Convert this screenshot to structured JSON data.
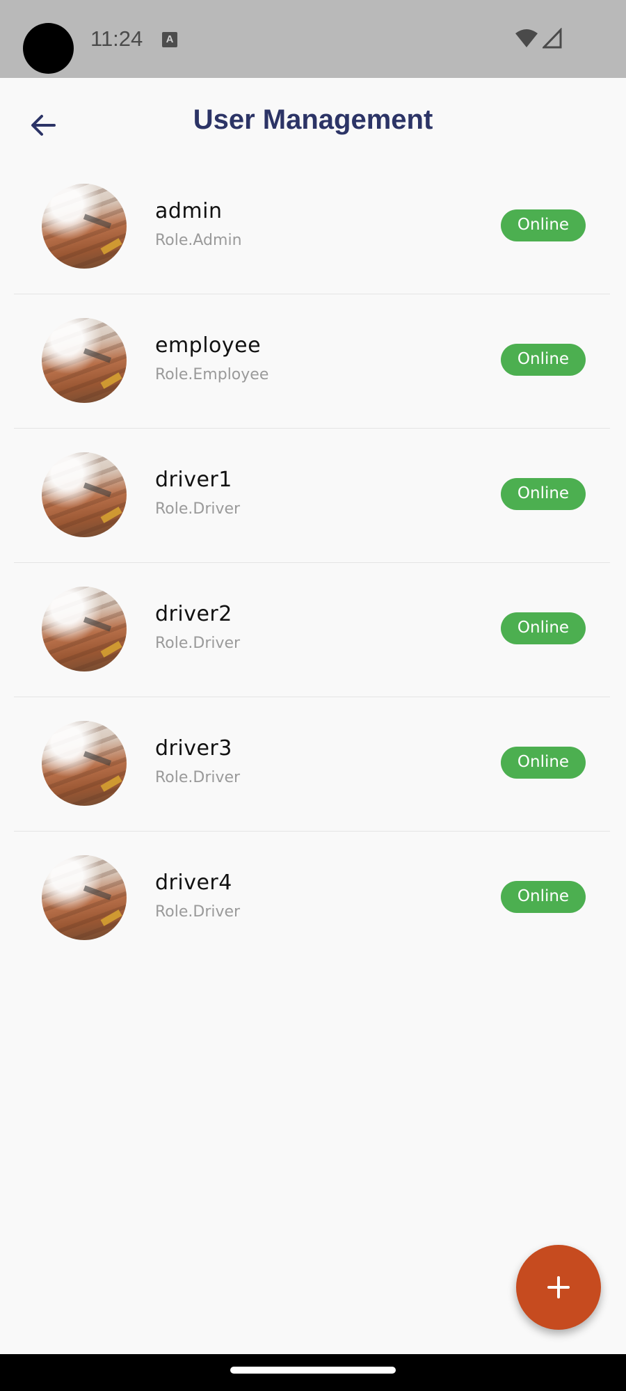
{
  "status_bar": {
    "time": "11:24",
    "notification_icon": "A"
  },
  "header": {
    "title": "User Management",
    "back_icon": "arrow-left-icon"
  },
  "users": [
    {
      "name": "admin",
      "role": "Role.Admin",
      "status": "Online"
    },
    {
      "name": "employee",
      "role": "Role.Employee",
      "status": "Online"
    },
    {
      "name": "driver1",
      "role": "Role.Driver",
      "status": "Online"
    },
    {
      "name": "driver2",
      "role": "Role.Driver",
      "status": "Online"
    },
    {
      "name": "driver3",
      "role": "Role.Driver",
      "status": "Online"
    },
    {
      "name": "driver4",
      "role": "Role.Driver",
      "status": "Online"
    }
  ],
  "fab": {
    "icon": "plus-icon"
  },
  "colors": {
    "title": "#2c3466",
    "online_badge": "#4caf50",
    "fab": "#c64b1f"
  }
}
